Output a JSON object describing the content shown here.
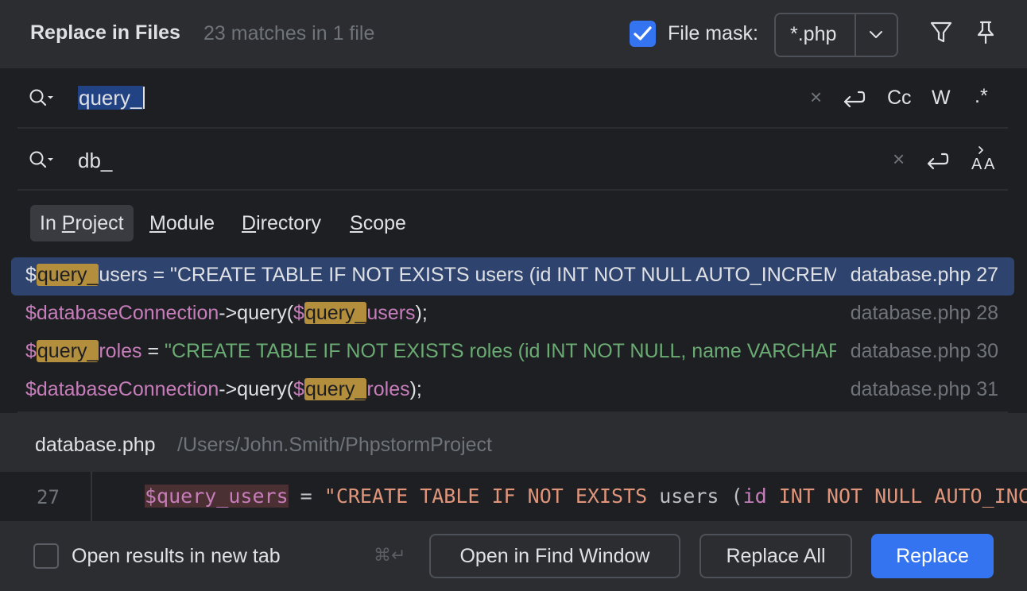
{
  "header": {
    "title": "Replace in Files",
    "match_summary": "23 matches in 1 file",
    "file_mask_label": "File mask:",
    "file_mask_value": "*.php",
    "file_mask_checked": true
  },
  "find": {
    "value": "query_",
    "options": [
      "Cc",
      "W",
      ".*"
    ]
  },
  "replace": {
    "value": "db_"
  },
  "scopes": [
    {
      "pre": "In ",
      "u": "P",
      "post": "roject",
      "active": true
    },
    {
      "pre": "",
      "u": "M",
      "post": "odule",
      "active": false
    },
    {
      "pre": "",
      "u": "D",
      "post": "irectory",
      "active": false
    },
    {
      "pre": "",
      "u": "S",
      "post": "cope",
      "active": false
    }
  ],
  "results": [
    {
      "selected": true,
      "segments": [
        {
          "t": "$",
          "c": "var"
        },
        {
          "t": "query_",
          "c": "hl"
        },
        {
          "t": "users",
          "c": "var"
        },
        {
          "t": " = ",
          "c": "plain"
        },
        {
          "t": "\"CREATE TABLE IF NOT EXISTS users (id INT NOT NULL AUTO_INCREMENT",
          "c": "str"
        }
      ],
      "file": "database.php 27"
    },
    {
      "selected": false,
      "segments": [
        {
          "t": "$databaseConnection",
          "c": "var"
        },
        {
          "t": "->query(",
          "c": "plain"
        },
        {
          "t": "$",
          "c": "var"
        },
        {
          "t": "query_",
          "c": "hl"
        },
        {
          "t": "users",
          "c": "var"
        },
        {
          "t": ");",
          "c": "plain"
        }
      ],
      "file": "database.php 28"
    },
    {
      "selected": false,
      "segments": [
        {
          "t": "$",
          "c": "var"
        },
        {
          "t": "query_",
          "c": "hl"
        },
        {
          "t": "roles",
          "c": "var"
        },
        {
          "t": " = ",
          "c": "plain"
        },
        {
          "t": "\"CREATE TABLE IF NOT EXISTS roles (id INT NOT NULL, name VARCHAR",
          "c": "str"
        }
      ],
      "file": "database.php 30"
    },
    {
      "selected": false,
      "segments": [
        {
          "t": "$databaseConnection",
          "c": "var"
        },
        {
          "t": "->query(",
          "c": "plain"
        },
        {
          "t": "$",
          "c": "var"
        },
        {
          "t": "query_",
          "c": "hl"
        },
        {
          "t": "roles",
          "c": "var"
        },
        {
          "t": ");",
          "c": "plain"
        }
      ],
      "file": "database.php 31"
    }
  ],
  "preview": {
    "file_name": "database.php",
    "path": "/Users/John.Smith/PhpstormProject",
    "line_number": "27",
    "code": [
      {
        "t": "$query_users",
        "c": "var"
      },
      {
        "t": " = ",
        "c": "plain"
      },
      {
        "t": "\"CREATE TABLE IF NOT EXISTS ",
        "c": "str"
      },
      {
        "t": "users (",
        "c": "plain"
      },
      {
        "t": "id",
        "c": "id"
      },
      {
        "t": " INT NOT NULL AUTO_INCREMENT",
        "c": "str"
      }
    ]
  },
  "footer": {
    "open_new_tab_label": "Open results in new tab",
    "open_new_tab_checked": false,
    "shortcut": "⌘↵",
    "open_find_window": "Open in Find Window",
    "replace_all": "Replace All",
    "replace": "Replace"
  },
  "colors": {
    "accent": "#3574f0",
    "highlight": "#b38f3d",
    "selection": "#2e436e"
  }
}
